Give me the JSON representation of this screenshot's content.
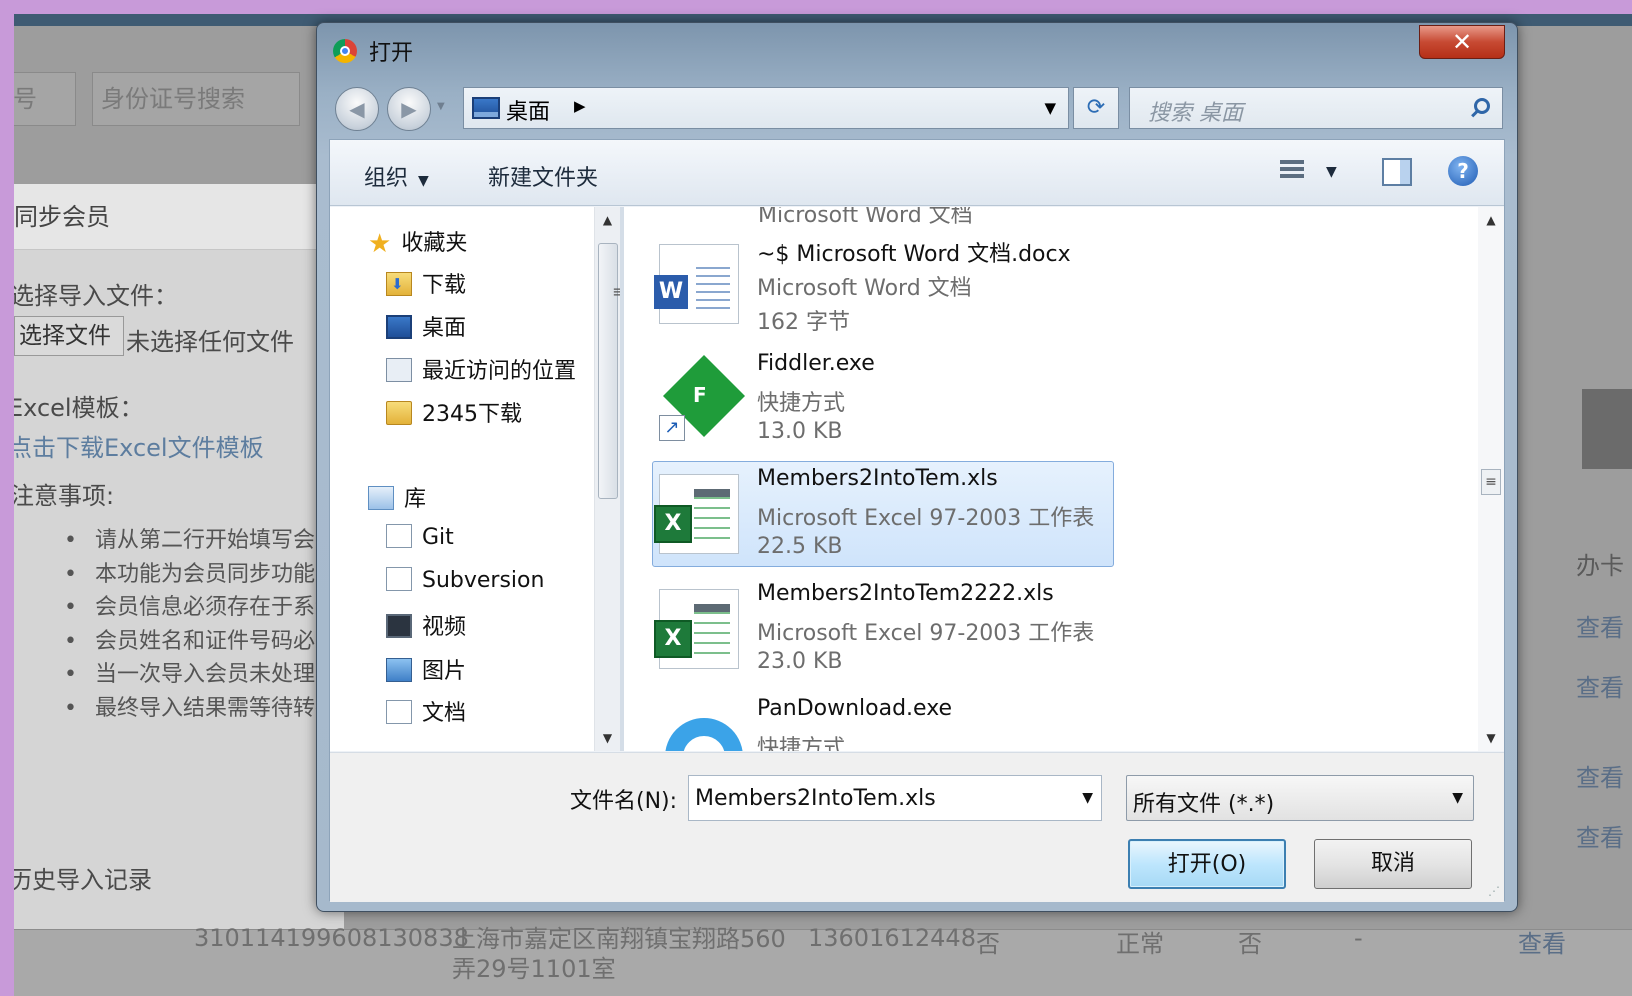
{
  "background_page": {
    "search_placeholder": "身份证号搜索",
    "left_fragment": "号",
    "panel_title": "同步会员",
    "select_file_label": "选择导入文件：",
    "choose_file_button": "选择文件",
    "no_file_text": "未选择任何文件",
    "excel_template_label": "Excel模板：",
    "download_template_link": "点击下载Excel文件模板",
    "notes_title": "注意事项:",
    "notes": [
      "请从第二行开始填写会员",
      "本功能为会员同步功能",
      "会员信息必须存在于系统",
      "会员姓名和证件号码必须",
      "当一次导入会员未处理完",
      "最终导入结果需等待转换"
    ],
    "history_title": "历史导入记录",
    "table_row": [
      "310114199608130838",
      "上海市嘉定区南翔镇宝翔路560弄29号1101室",
      "13601612448",
      "否",
      "正常",
      "否",
      "-",
      "查看"
    ],
    "right_column": [
      "办卡",
      "查看",
      "查看",
      "查看",
      "查看"
    ]
  },
  "dialog": {
    "title": "打开",
    "close_symbol": "✕",
    "address": {
      "location": "桌面",
      "arrow": "▶",
      "dropdown": "▼"
    },
    "refresh_symbol": "⟳",
    "search_placeholder": "搜索 桌面",
    "toolbar": {
      "organize": "组织",
      "new_folder": "新建文件夹",
      "help": "?"
    },
    "nav_pane": {
      "favorites_title": "收藏夹",
      "favorites": [
        "下载",
        "桌面",
        "最近访问的位置",
        "2345下载"
      ],
      "libraries_title": "库",
      "libraries": [
        "Git",
        "Subversion",
        "视频",
        "图片",
        "文档"
      ]
    },
    "files": {
      "partial_top": "Microsoft Word 文档",
      "items": [
        {
          "name": "~$ Microsoft Word 文档.docx",
          "type": "Microsoft Word 文档",
          "size": "162 字节",
          "icon": "word-doc-icon"
        },
        {
          "name": "Fiddler.exe",
          "type": "快捷方式",
          "size": "13.0 KB",
          "icon": "fiddler-shortcut-icon"
        },
        {
          "name": "Members2IntoTem.xls",
          "type": "Microsoft Excel 97-2003 工作表",
          "size": "22.5 KB",
          "icon": "excel-file-icon",
          "selected": true
        },
        {
          "name": "Members2IntoTem2222.xls",
          "type": "Microsoft Excel 97-2003 工作表",
          "size": "23.0 KB",
          "icon": "excel-file-icon"
        },
        {
          "name": "PanDownload.exe",
          "type": "快捷方式",
          "size": "",
          "icon": "pandownload-shortcut-icon"
        }
      ]
    },
    "filename_label": "文件名(N):",
    "filename_value": "Members2IntoTem.xls",
    "filetype_value": "所有文件 (*.*)",
    "open_button": "打开(O)",
    "cancel_button": "取消"
  }
}
